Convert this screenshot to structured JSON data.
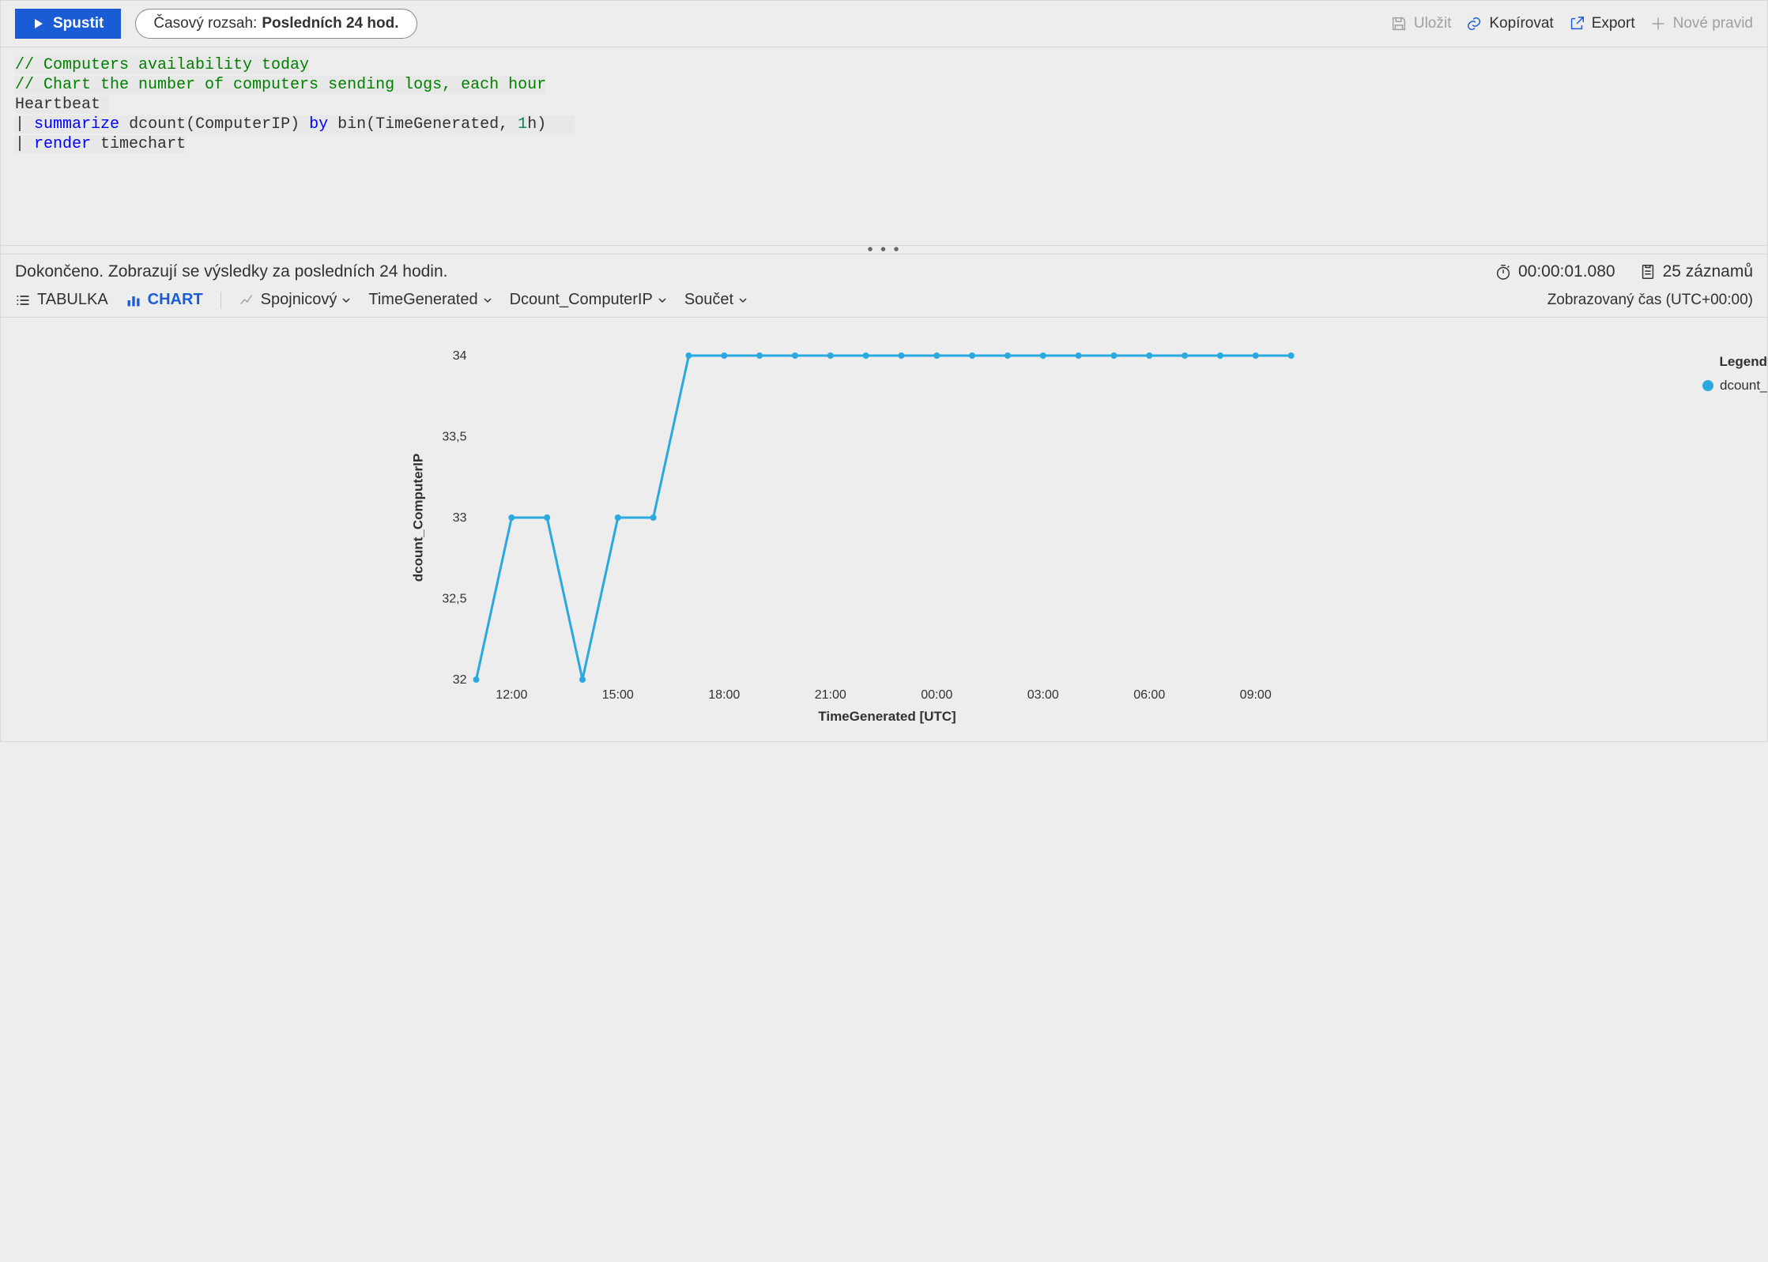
{
  "toolbar": {
    "run_label": "Spustit",
    "time_range_label": "Časový rozsah:",
    "time_range_value": "Posledních 24 hod.",
    "save_label": "Uložit",
    "copy_label": "Kopírovat",
    "export_label": "Export",
    "new_rule_label": "Nové pravid"
  },
  "editor": {
    "line1": "// Computers availability today",
    "line2": "// Chart the number of computers sending logs, each hour",
    "line3_table": "Heartbeat",
    "line4_pipe": "|",
    "line4_kw": "summarize",
    "line4_rest_a": " dcount(ComputerIP) ",
    "line4_by": "by",
    "line4_rest_b": " bin(TimeGenerated, ",
    "line4_num": "1",
    "line4_unit": "h)",
    "line5_pipe": "|",
    "line5_kw": "render",
    "line5_rest": " timechart"
  },
  "status": {
    "message": "Dokončeno. Zobrazují se výsledky za posledních 24 hodin.",
    "duration": "00:00:01.080",
    "records": "25 záznamů"
  },
  "viewbar": {
    "table_label": "TABULKA",
    "chart_label": "CHART",
    "chart_type": "Spojnicový",
    "x_field": "TimeGenerated",
    "y_field": "Dcount_ComputerIP",
    "agg": "Součet",
    "tz_label": "Zobrazovaný čas (UTC+00:00)"
  },
  "legend": {
    "title": "Legend",
    "series_label": "dcount_Compu"
  },
  "chart_data": {
    "type": "line",
    "title": "",
    "xlabel": "TimeGenerated [UTC]",
    "ylabel": "dcount_ComputerIP",
    "ylim": [
      32,
      34
    ],
    "y_ticks": [
      32,
      32.5,
      33,
      33.5,
      34
    ],
    "y_tick_labels": [
      "32",
      "32,5",
      "33",
      "33,5",
      "34"
    ],
    "x_tick_labels": [
      "12:00",
      "15:00",
      "18:00",
      "21:00",
      "00:00",
      "03:00",
      "06:00",
      "09:00"
    ],
    "x_tick_hours": [
      12,
      15,
      18,
      21,
      24,
      27,
      30,
      33
    ],
    "series": [
      {
        "name": "dcount_ComputerIP",
        "color": "#2aa9e0",
        "x_hours": [
          11,
          12,
          13,
          14,
          15,
          16,
          17,
          18,
          19,
          20,
          21,
          22,
          23,
          24,
          25,
          26,
          27,
          28,
          29,
          30,
          31,
          32,
          33,
          34
        ],
        "values": [
          32,
          33,
          33,
          32,
          33,
          33,
          34,
          34,
          34,
          34,
          34,
          34,
          34,
          34,
          34,
          34,
          34,
          34,
          34,
          34,
          34,
          34,
          34,
          34
        ]
      }
    ]
  }
}
